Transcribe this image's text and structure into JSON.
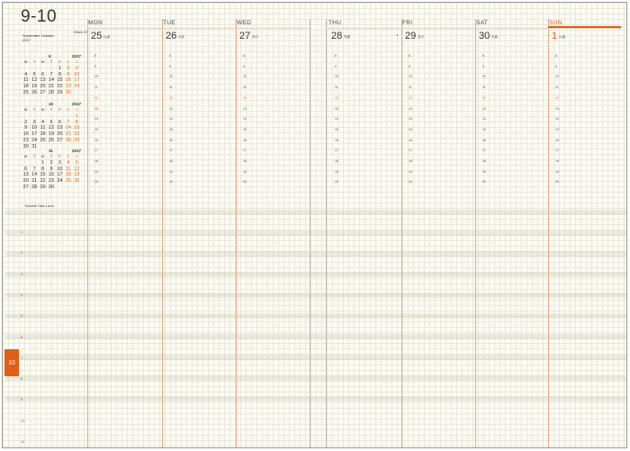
{
  "header": {
    "month_range": "9-10",
    "week_label": "Week 39",
    "month_names": "September October",
    "year": "2017"
  },
  "mini_calendars": [
    {
      "month": "9",
      "year": "2017",
      "dow": [
        "M",
        "T",
        "W",
        "T",
        "F",
        "S",
        "S"
      ],
      "weeks": [
        [
          "",
          "",
          "",
          "",
          "1",
          "2",
          "3"
        ],
        [
          "4",
          "5",
          "6",
          "7",
          "8",
          "9",
          "10"
        ],
        [
          "11",
          "12",
          "13",
          "14",
          "15",
          "16",
          "17"
        ],
        [
          "18",
          "19",
          "20",
          "21",
          "22",
          "23",
          "24"
        ],
        [
          "25",
          "26",
          "27",
          "28",
          "29",
          "30",
          ""
        ]
      ]
    },
    {
      "month": "10",
      "year": "2017",
      "dow": [
        "M",
        "T",
        "W",
        "T",
        "F",
        "S",
        "S"
      ],
      "weeks": [
        [
          "",
          "",
          "",
          "",
          "",
          "",
          "1"
        ],
        [
          "2",
          "3",
          "4",
          "5",
          "6",
          "7",
          "8"
        ],
        [
          "9",
          "10",
          "11",
          "12",
          "13",
          "14",
          "15"
        ],
        [
          "16",
          "17",
          "18",
          "19",
          "20",
          "21",
          "22"
        ],
        [
          "23",
          "24",
          "25",
          "26",
          "27",
          "28",
          "29"
        ],
        [
          "30",
          "31",
          "",
          "",
          "",
          "",
          ""
        ]
      ]
    },
    {
      "month": "11",
      "year": "2017",
      "dow": [
        "M",
        "T",
        "W",
        "T",
        "F",
        "S",
        "S"
      ],
      "weeks": [
        [
          "",
          "",
          "1",
          "2",
          "3",
          "4",
          "5"
        ],
        [
          "6",
          "7",
          "8",
          "9",
          "10",
          "11",
          "12"
        ],
        [
          "13",
          "14",
          "15",
          "16",
          "17",
          "18",
          "19"
        ],
        [
          "20",
          "21",
          "22",
          "23",
          "24",
          "25",
          "26"
        ],
        [
          "27",
          "28",
          "29",
          "30",
          "",
          "",
          ""
        ]
      ]
    }
  ],
  "task_list_label": "Todolist Task Lane",
  "left_hours": [
    "1",
    "2",
    "3",
    "4",
    "5",
    "6",
    "7",
    "8",
    "9",
    "10",
    "11"
  ],
  "current_hour_tab": "10",
  "days": [
    {
      "name": "MON",
      "date": "25",
      "note": "仏滅"
    },
    {
      "name": "TUE",
      "date": "26",
      "note": "大安"
    },
    {
      "name": "WED",
      "date": "27",
      "note": "赤口"
    },
    {
      "name": "THU",
      "date": "28",
      "note": "先勝"
    },
    {
      "name": "FRI",
      "date": "29",
      "note": "友引"
    },
    {
      "name": "SAT",
      "date": "30",
      "note": "先負"
    },
    {
      "name": "SUN",
      "date": "1",
      "note": "仏滅"
    }
  ],
  "hour_labels": [
    "8",
    "9",
    "10",
    "11",
    "12",
    "13",
    "14",
    "15",
    "16",
    "17",
    "18",
    "19",
    "20"
  ],
  "colors": {
    "accent": "#e25d17",
    "grid": "#e8e8dc"
  }
}
